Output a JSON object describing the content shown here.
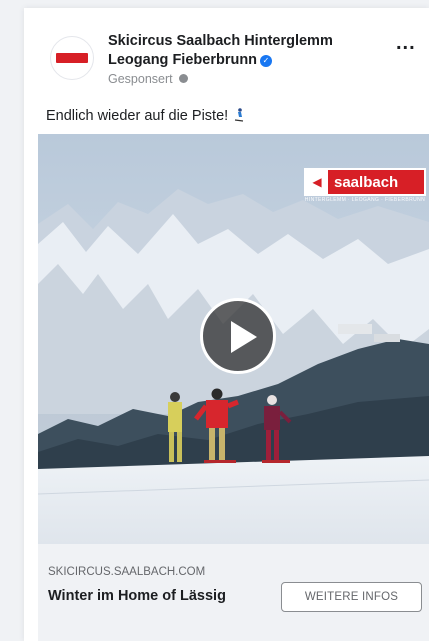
{
  "post": {
    "page_name": "Skicircus Saalbach Hinterglemm Leogang Fieberbrunn",
    "sponsored_label": "Gesponsert",
    "text": "Endlich wieder auf die Piste!",
    "more_label": "...",
    "brand_logo_text": "saalbach",
    "brand_logo_tagline": "HINTERGLEMM · LEOGANG · FIEBERBRUNN"
  },
  "cta": {
    "domain": "SKICIRCUS.SAALBACH.COM",
    "headline": "Winter im Home of Lässig",
    "button_label": "WEITERE INFOS"
  },
  "icons": {
    "verified": "verified-badge-icon",
    "globe": "globe-icon",
    "more": "more-options-icon",
    "play": "play-icon"
  },
  "colors": {
    "brand_red": "#d71f26",
    "verified_blue": "#1877f2",
    "cta_background": "#f0f2f5"
  }
}
